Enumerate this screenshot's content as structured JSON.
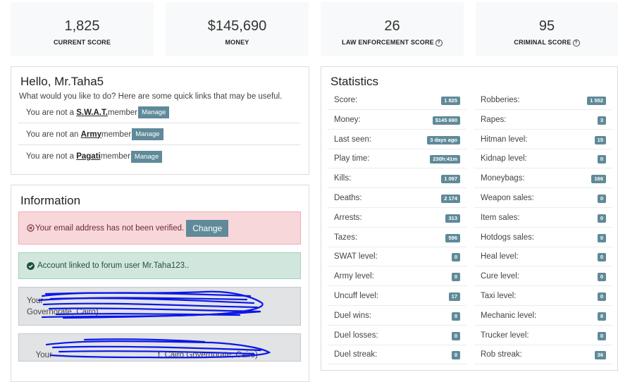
{
  "stats_cards": [
    {
      "value": "1,825",
      "label": "CURRENT SCORE",
      "help": false
    },
    {
      "value": "$145,690",
      "label": "MONEY",
      "help": false
    },
    {
      "value": "26",
      "label": "LAW ENFORCEMENT SCORE",
      "help": true
    },
    {
      "value": "95",
      "label": "CRIMINAL SCORE",
      "help": true
    }
  ],
  "hello": {
    "title": "Hello, Mr.Taha5",
    "intro": "What would you like to do? Here are some quick links that may be useful.",
    "links": [
      {
        "prefix": "You are not a ",
        "group": "S.W.A.T.",
        "suffix": " member",
        "button": "Manage"
      },
      {
        "prefix": "You are not an ",
        "group": "Army",
        "suffix": " member",
        "button": "Manage"
      },
      {
        "prefix": "You are not a ",
        "group": "Pagati",
        "suffix": " member",
        "button": "Manage"
      }
    ]
  },
  "information": {
    "title": "Information",
    "email_alert": "Your email address has not been verified.",
    "change_button": "Change",
    "forum_alert": "Account linked to forum user Mr.Taha123..",
    "redacted_1_line1": "Your",
    "redacted_1_line2": "Governorate, Cairo)",
    "redacted_2": "Your                                               t, Cairo Governorate, Cairo)"
  },
  "statistics": {
    "title": "Statistics",
    "left": [
      {
        "name": "Score:",
        "value": "1 825"
      },
      {
        "name": "Money:",
        "value": "$145 690"
      },
      {
        "name": "Last seen:",
        "value": "3 days ago"
      },
      {
        "name": "Play time:",
        "value": "230h:41m"
      },
      {
        "name": "Kills:",
        "value": "1 097"
      },
      {
        "name": "Deaths:",
        "value": "2 174"
      },
      {
        "name": "Arrests:",
        "value": "313"
      },
      {
        "name": "Tazes:",
        "value": "596"
      },
      {
        "name": "SWAT level:",
        "value": "0"
      },
      {
        "name": "Army level:",
        "value": "0"
      },
      {
        "name": "Uncuff level:",
        "value": "17"
      },
      {
        "name": "Duel wins:",
        "value": "0"
      },
      {
        "name": "Duel losses:",
        "value": "0"
      },
      {
        "name": "Duel streak:",
        "value": "0"
      }
    ],
    "right": [
      {
        "name": "Robberies:",
        "value": "1 552"
      },
      {
        "name": "Rapes:",
        "value": "3"
      },
      {
        "name": "Hitman level:",
        "value": "15"
      },
      {
        "name": "Kidnap level:",
        "value": "0"
      },
      {
        "name": "Moneybags:",
        "value": "166"
      },
      {
        "name": "Weapon sales:",
        "value": "0"
      },
      {
        "name": "Item sales:",
        "value": "0"
      },
      {
        "name": "Hotdogs sales:",
        "value": "0"
      },
      {
        "name": "Heal level:",
        "value": "0"
      },
      {
        "name": "Cure level:",
        "value": "0"
      },
      {
        "name": "Taxi level:",
        "value": "0"
      },
      {
        "name": "Mechanic level:",
        "value": "8"
      },
      {
        "name": "Trucker level:",
        "value": "0"
      },
      {
        "name": "Rob streak:",
        "value": "36"
      }
    ]
  },
  "colors": {
    "badge": "#5f8a99",
    "scribble": "#0a17e8"
  }
}
